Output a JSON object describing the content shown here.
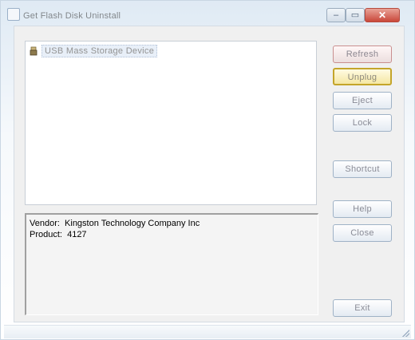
{
  "window": {
    "title": "Get Flash Disk Uninstall",
    "caption": {
      "minimize": "–",
      "maximize": "▭",
      "close": "✕"
    }
  },
  "device_list": {
    "items": [
      {
        "label": "USB Mass Storage Device",
        "icon": "usb-drive-icon"
      }
    ]
  },
  "details": {
    "vendor": "Vendor:  Kingston Technology Company Inc",
    "product": "Product:  4127"
  },
  "buttons": {
    "refresh": "Refresh",
    "unplug": "Unplug",
    "eject": "Eject",
    "lock": "Lock",
    "shortcut": "Shortcut",
    "help": "Help",
    "close": "Close",
    "exit": "Exit"
  },
  "colors": {
    "default_button_border": "#c4a52a",
    "close_button": "#c9473a"
  }
}
